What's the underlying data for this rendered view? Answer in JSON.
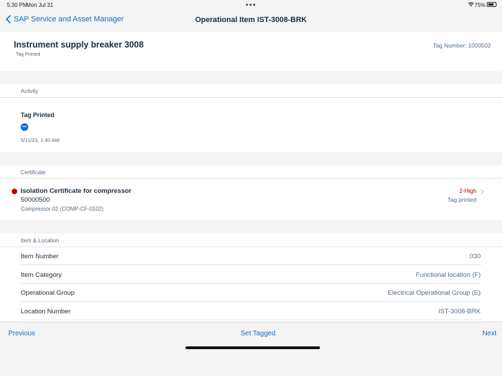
{
  "status_bar": {
    "time": "5:30 PM",
    "date": "Mon Jul 31",
    "battery": "75%",
    "battery_level": 0.75
  },
  "nav": {
    "back_label": "SAP Service and Asset Manager",
    "title": "Operational Item IST-3008-BRK"
  },
  "header": {
    "title": "Instrument supply breaker 3008",
    "subtitle": "Tag Printed",
    "tag_number": "Tag Number: 1000502"
  },
  "activity": {
    "section_label": "Activity",
    "title": "Tag Printed",
    "timestamp": "5/11/23, 1:40 AM"
  },
  "certificate": {
    "section_label": "Certificate",
    "title": "Isolation Certificate for compressor",
    "number": "50000500",
    "subtitle": "Compressor 02 (COMP-CF-0102)",
    "priority": "2-High",
    "status": "Tag printed",
    "priority_color": "#bb0000"
  },
  "item_location": {
    "section_label": "Item & Location",
    "rows": [
      {
        "label": "Item Number",
        "value": "030"
      },
      {
        "label": "Item Category",
        "value": "Functional location (F)"
      },
      {
        "label": "Operational Group",
        "value": "Electrical Operational Group (E)"
      },
      {
        "label": "Location Number",
        "value": "IST-3008-BRK"
      }
    ]
  },
  "footer": {
    "previous": "Previous",
    "center": "Set Tagged",
    "next": "Next"
  },
  "colors": {
    "accent": "#0a6ed1",
    "high_priority": "#bb0000"
  }
}
